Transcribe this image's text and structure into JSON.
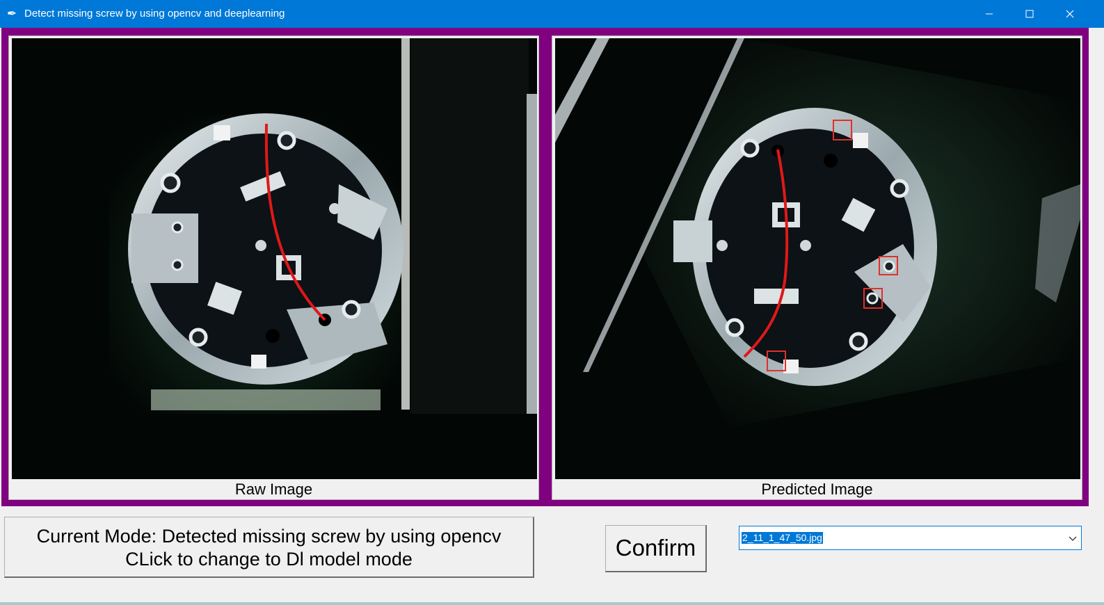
{
  "window": {
    "title": "Detect missing screw by using opencv and deeplearning",
    "app_icon": "feather-icon",
    "controls": [
      "minimize-icon",
      "maximize-icon",
      "close-icon"
    ]
  },
  "colors": {
    "titlebar": "#0078d7",
    "frame": "#800080",
    "selection": "#0078d7",
    "annotation_box": "#e0302a",
    "cable": "#e01818"
  },
  "panels": {
    "raw": {
      "label": "Raw Image"
    },
    "predicted": {
      "label": "Predicted Image"
    }
  },
  "mode_button": {
    "line1": "Current Mode: Detected missing screw by using opencv",
    "line2": "CLick to change to Dl model mode"
  },
  "confirm_button": {
    "label": "Confirm"
  },
  "file_select": {
    "value": "2_11_1_47_50.jpg",
    "icon": "chevron-down-icon"
  }
}
